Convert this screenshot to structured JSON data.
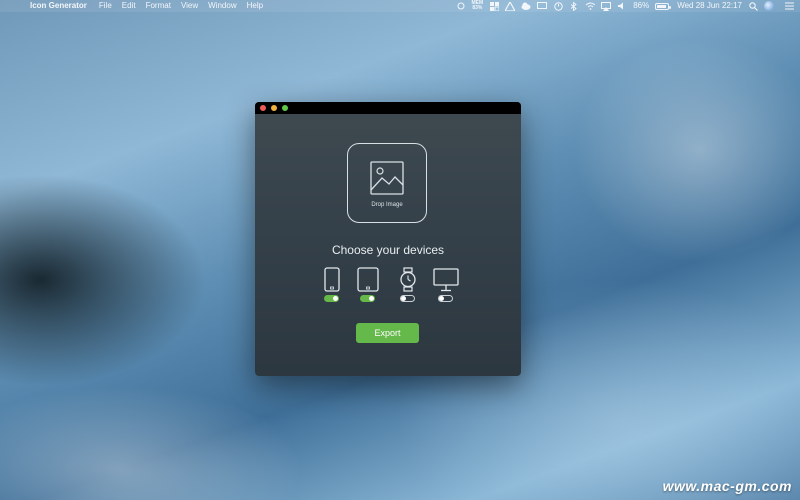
{
  "menubar": {
    "app_name": "Icon Generator",
    "menus": [
      "File",
      "Edit",
      "Format",
      "View",
      "Window",
      "Help"
    ],
    "memory_label": "MEM",
    "memory_value": "83%",
    "battery_percent_text": "86%",
    "battery_fraction": 0.86,
    "datetime": "Wed 28 Jun  22:17"
  },
  "window": {
    "drop_label": "Drop Image",
    "heading": "Choose your devices",
    "devices": [
      {
        "name": "iPhone",
        "icon": "phone-icon",
        "enabled": true
      },
      {
        "name": "iPad",
        "icon": "tablet-icon",
        "enabled": true
      },
      {
        "name": "Apple Watch",
        "icon": "watch-icon",
        "enabled": false
      },
      {
        "name": "Mac",
        "icon": "monitor-icon",
        "enabled": false
      }
    ],
    "export_label": "Export"
  },
  "watermark": "www.mac-gm.com",
  "colors": {
    "accent_green": "#65b84a",
    "window_bg": "#35414a",
    "close": "#ee5c55",
    "minimize": "#f3b240",
    "zoom": "#60c84b"
  }
}
